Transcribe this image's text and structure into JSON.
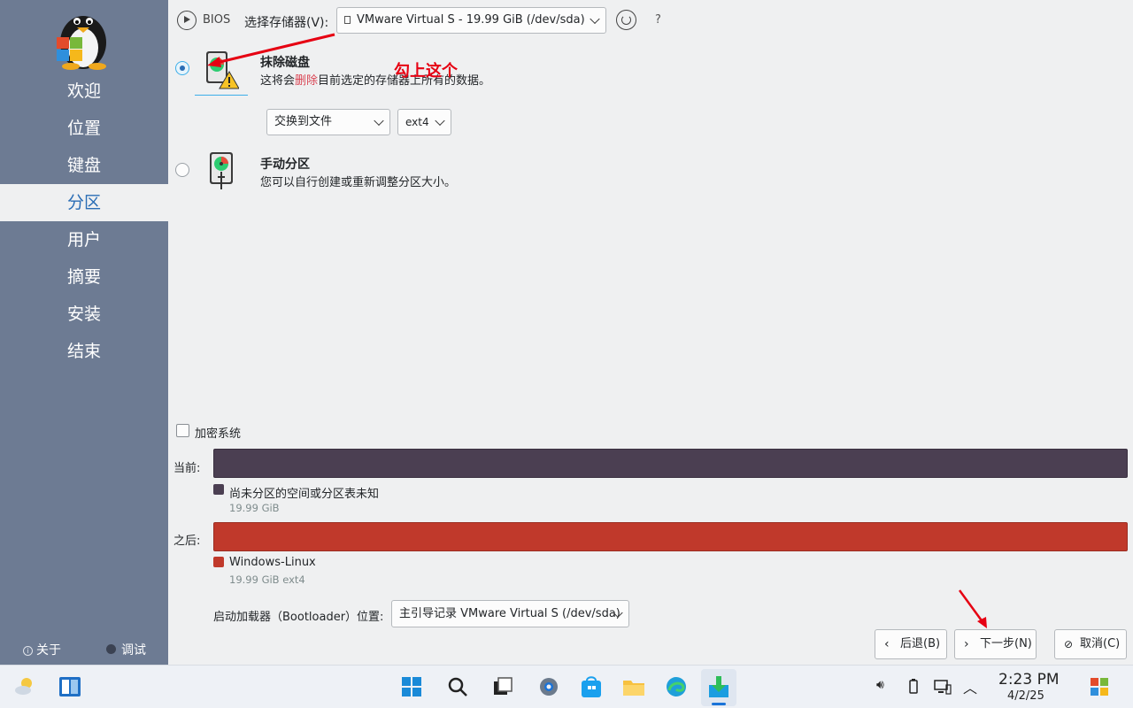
{
  "sidebar": {
    "items": [
      {
        "label": "欢迎"
      },
      {
        "label": "位置"
      },
      {
        "label": "键盘"
      },
      {
        "label": "分区",
        "active": true
      },
      {
        "label": "用户"
      },
      {
        "label": "摘要"
      },
      {
        "label": "安装"
      },
      {
        "label": "结束"
      }
    ],
    "about_label": "关于",
    "debug_label": "调试"
  },
  "topbar": {
    "bios_label": "BIOS",
    "storage_label": "选择存储器(V):",
    "storage_value": "VMware Virtual S - 19.99 GiB (/dev/sda)",
    "help_label": "?"
  },
  "options": {
    "erase": {
      "title": "抹除磁盘",
      "desc_prefix": "这将会",
      "desc_highlight": "删除",
      "desc_suffix": "目前选定的存储器上所有的数据。",
      "selected": true
    },
    "swap_value": "交换到文件",
    "fs_value": "ext4",
    "manual": {
      "title": "手动分区",
      "desc": "您可以自行创建或重新调整分区大小。",
      "selected": false
    }
  },
  "annotation": {
    "text": "勾上这个"
  },
  "encrypt": {
    "label": "加密系统",
    "checked": false
  },
  "partitions": {
    "current_label": "当前:",
    "current_legend_name": "尚未分区的空间或分区表未知",
    "current_legend_size": "19.99 GiB",
    "after_label": "之后:",
    "after_legend_name": "Windows-Linux",
    "after_legend_size": "19.99 GiB  ext4"
  },
  "bootloader": {
    "label": "启动加载器（Bootloader）位置:",
    "value": "主引导记录 VMware Virtual S (/dev/sda)"
  },
  "buttons": {
    "back": "后退(B)",
    "next": "下一步(N)",
    "cancel": "取消(C)"
  },
  "taskbar": {
    "time": "2:23 PM",
    "date": "4/2/25"
  },
  "colors": {
    "sidebar_bg": "#6d7b93",
    "accent": "#2a6db5",
    "current_bar": "#4b3f52",
    "after_bar": "#c0392b",
    "annotation": "#e60012"
  }
}
